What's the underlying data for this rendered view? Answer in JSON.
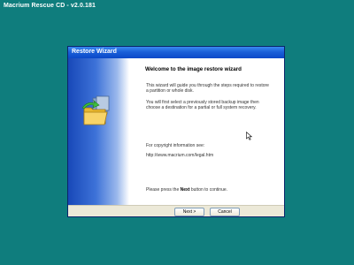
{
  "app": {
    "title": "Macrium Rescue CD - v2.0.181"
  },
  "wizard": {
    "title": "Restore Wizard",
    "heading": "Welcome to the image restore wizard",
    "intro": "This wizard will guide you through the steps required to restore a partition or whole disk.",
    "instructions": "You will first select a previously stored backup image then choose a destination for a partial or full system recovery.",
    "copyright_label": "For copyright information see:",
    "copyright_url": "http://www.macrium.com/legal.htm",
    "continue_prefix": "Please press the ",
    "continue_bold": "Next",
    "continue_suffix": " button to continue.",
    "next_label": "Next >",
    "cancel_label": "Cancel"
  },
  "colors": {
    "desktop": "#0f7d7d",
    "titlebar": "#1a5fd8",
    "dialog": "#ece9d8"
  },
  "icons": {
    "wizard_graphic": "folder-restore-icon",
    "pointer": "mouse-cursor-icon"
  }
}
